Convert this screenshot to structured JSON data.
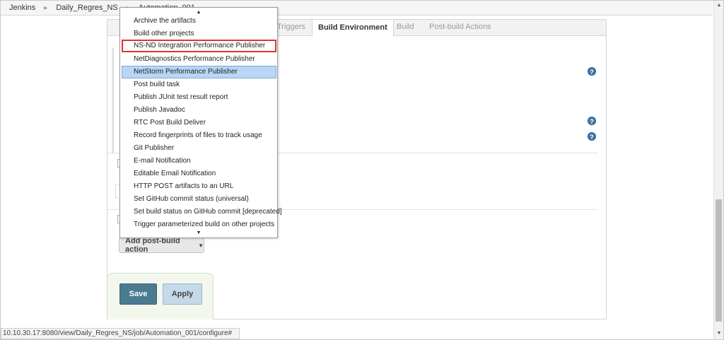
{
  "breadcrumb": {
    "items": [
      "Jenkins",
      "Daily_Regres_NS",
      "Automation_001"
    ],
    "separator": "▸"
  },
  "tabs": [
    {
      "label": "Triggers",
      "active": false
    },
    {
      "label": "Build Environment",
      "active": true
    },
    {
      "label": "Build",
      "active": false
    },
    {
      "label": "Post-build Actions",
      "active": false
    }
  ],
  "dropdown": {
    "scroll_up": "▲",
    "scroll_down": "▼",
    "items": [
      {
        "label": "Archive the artifacts"
      },
      {
        "label": "Build other projects"
      },
      {
        "label": "NS-ND Integration Performance Publisher",
        "outlined": true
      },
      {
        "label": "NetDiagnostics Performance Publisher"
      },
      {
        "label": "NetStorm Performance Publisher",
        "highlighted": true
      },
      {
        "label": "Post build task"
      },
      {
        "label": "Publish JUnit test result report"
      },
      {
        "label": "Publish Javadoc"
      },
      {
        "label": "RTC Post Build Deliver"
      },
      {
        "label": "Record fingerprints of files to track usage"
      },
      {
        "label": "Git Publisher"
      },
      {
        "label": "E-mail Notification"
      },
      {
        "label": "Editable Email Notification"
      },
      {
        "label": "HTTP POST artifacts to an URL"
      },
      {
        "label": "Set GitHub commit status (universal)"
      },
      {
        "label": "Set build status on GitHub commit [deprecated]"
      },
      {
        "label": "Trigger parameterized build on other projects"
      }
    ]
  },
  "post_build": {
    "add_label": "Add post-build action",
    "caret": "▼"
  },
  "actions": {
    "save": "Save",
    "apply": "Apply"
  },
  "help_glyph": "?",
  "status_url": "10.10.30.17:8080/view/Daily_Regres_NS/job/Automation_001/configure#",
  "scrollbar": {
    "up": "▲",
    "down": "▼"
  },
  "colors": {
    "save_bg": "#4c7b91",
    "apply_bg": "#c5d9ea",
    "highlight": "#b9d6f5",
    "outline": "#e2322f",
    "help_icon": "#3f79ae"
  }
}
